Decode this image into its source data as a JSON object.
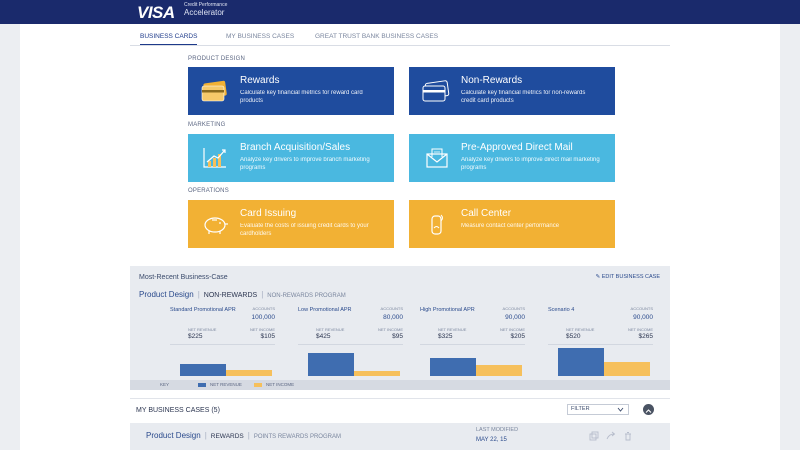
{
  "brand": {
    "logo": "VISA",
    "app_line1": "Credit Performance",
    "app_line2": "Accelerator"
  },
  "nav": {
    "tabs": [
      {
        "label": "BUSINESS CARDS",
        "active": true
      },
      {
        "label": "MY BUSINESS CASES",
        "active": false
      },
      {
        "label": "GREAT TRUST BANK BUSINESS CASES",
        "active": false
      }
    ]
  },
  "sections": {
    "product_design": {
      "label": "PRODUCT DESIGN",
      "cards": [
        {
          "title": "Rewards",
          "desc": "Calculate key financial metrics for reward card products",
          "icon": "card-icon"
        },
        {
          "title": "Non-Rewards",
          "desc": "Calculate key financial metrics for non-rewards credit card products",
          "icon": "card-icon"
        }
      ]
    },
    "marketing": {
      "label": "MARKETING",
      "cards": [
        {
          "title": "Branch Acquisition/Sales",
          "desc": "Analyze key drivers to improve branch marketing programs",
          "icon": "growth-chart-icon"
        },
        {
          "title": "Pre-Approved Direct Mail",
          "desc": "Analyze key drivers to improve direct mail marketing programs",
          "icon": "mail-icon"
        }
      ]
    },
    "operations": {
      "label": "OPERATIONS",
      "cards": [
        {
          "title": "Card Issuing",
          "desc": "Evaluate the costs of issuing credit cards to your cardholders",
          "icon": "piggy-bank-icon"
        },
        {
          "title": "Call Center",
          "desc": "Measure contact center performance",
          "icon": "phone-icon"
        }
      ]
    }
  },
  "recent": {
    "title": "Most-Recent Business-Case",
    "edit_label": "EDIT BUSINESS CASE",
    "crumb_1": "Product Design",
    "crumb_2": "NON-REWARDS",
    "crumb_3": "NON-REWARDS PROGRAM",
    "scenarios": [
      {
        "name": "Standard Promotional APR",
        "accounts_label": "ACCOUNTS",
        "accounts": "100,000",
        "rev_label": "NET REVENUE",
        "rev": "$225",
        "inc_label": "NET INCOME",
        "inc": "$105",
        "rev_value": 225,
        "inc_value": 105
      },
      {
        "name": "Low Promotional APR",
        "accounts_label": "ACCOUNTS",
        "accounts": "80,000",
        "rev_label": "NET REVENUE",
        "rev": "$425",
        "inc_label": "NET INCOME",
        "inc": "$95",
        "rev_value": 425,
        "inc_value": 95
      },
      {
        "name": "High Promotional APR",
        "accounts_label": "ACCOUNTS",
        "accounts": "90,000",
        "rev_label": "NET REVENUE",
        "rev": "$325",
        "inc_label": "NET INCOME",
        "inc": "$205",
        "rev_value": 325,
        "inc_value": 205
      },
      {
        "name": "Scenario 4",
        "accounts_label": "ACCOUNTS",
        "accounts": "90,000",
        "rev_label": "NET REVENUE",
        "rev": "$520",
        "inc_label": "NET INCOME",
        "inc": "$265",
        "rev_value": 520,
        "inc_value": 265
      }
    ],
    "key": {
      "label": "KEY",
      "revenue": "NET REVENUE",
      "income": "NET INCOME"
    }
  },
  "my_cases": {
    "title": "MY BUSINESS CASES (5)",
    "filter_label": "FILTER",
    "row": {
      "crumb_1": "Product Design",
      "crumb_2": "REWARDS",
      "crumb_3": "POINTS REWARDS PROGRAM",
      "modified_label": "LAST MODIFIED",
      "modified_value": "MAY 22, 15"
    }
  },
  "colors": {
    "nav_blue": "#1a2a6c",
    "card_blue": "#1f4c9e",
    "card_cyan": "#4ab8e0",
    "card_gold": "#f2b134",
    "bar_revenue": "#3f6db0",
    "bar_income": "#f6c05c"
  }
}
